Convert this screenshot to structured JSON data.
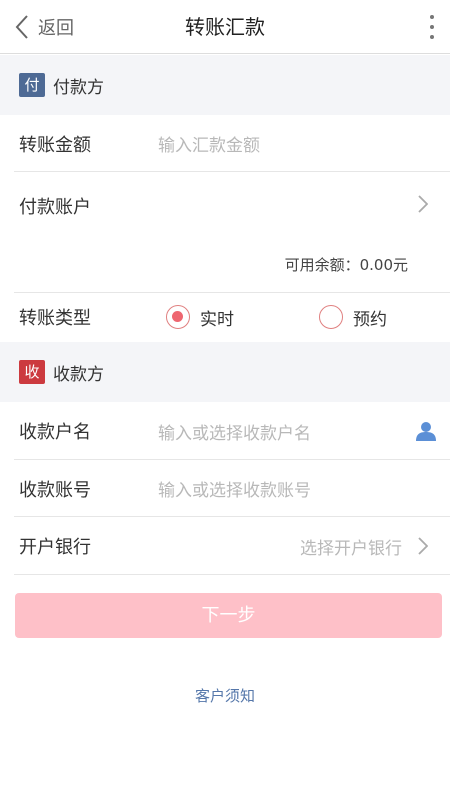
{
  "header": {
    "back_label": "返回",
    "title": "转账汇款"
  },
  "payer": {
    "section_badge": "付",
    "section_label": "付款方",
    "amount_label": "转账金额",
    "amount_placeholder": "输入汇款金额",
    "account_label": "付款账户",
    "balance_text": "可用余额：0.00元",
    "transfer_type_label": "转账类型",
    "options": [
      {
        "label": "实时",
        "selected": true
      },
      {
        "label": "预约",
        "selected": false
      }
    ]
  },
  "payee": {
    "section_badge": "收",
    "section_label": "收款方",
    "name_label": "收款户名",
    "name_placeholder": "输入或选择收款户名",
    "account_label": "收款账号",
    "account_placeholder": "输入或选择收款账号",
    "bank_label": "开户银行",
    "bank_placeholder": "选择开户银行"
  },
  "actions": {
    "next_label": "下一步",
    "notice_label": "客户须知"
  },
  "colors": {
    "accent": "#ee6670",
    "button_disabled": "#fec0c8",
    "link": "#5577aa",
    "payer_badge": "#4e6a95",
    "payee_badge": "#cc3a3f",
    "section_bg": "#f4f5f8"
  },
  "icons": {
    "back": "chevron-left-icon",
    "more": "more-vertical-icon",
    "chevron": "chevron-right-icon",
    "contact": "person-icon"
  }
}
